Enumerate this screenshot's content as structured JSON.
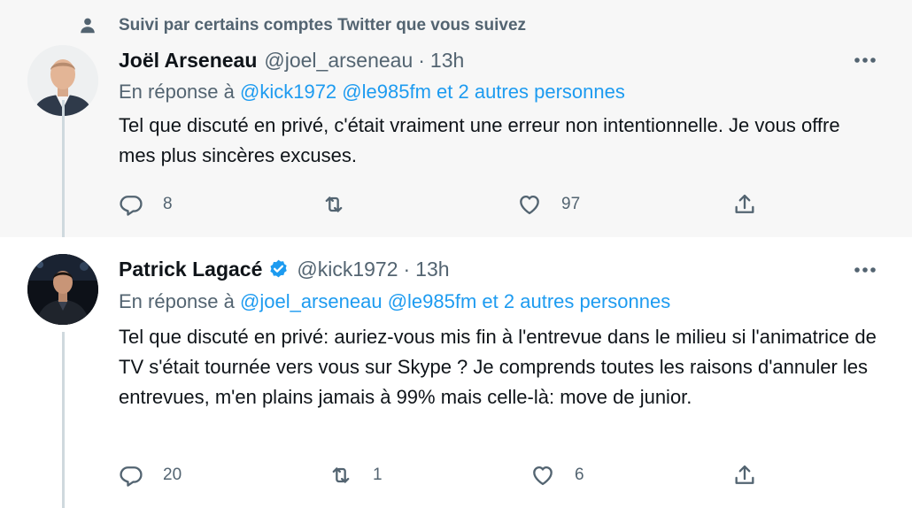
{
  "social_context": {
    "text": "Suivi par certains comptes Twitter que vous suivez",
    "icon": "person-icon"
  },
  "tweets": [
    {
      "name": "Joël Arseneau",
      "handle": "@joel_arseneau",
      "separator": "·",
      "time": "13h",
      "verified": false,
      "reply_prefix": "En réponse à",
      "reply_links": [
        "@kick1972",
        "@le985fm",
        "et 2 autres personnes"
      ],
      "body": "Tel que discuté en privé, c'était vraiment une erreur non intentionnelle. Je vous offre mes plus sincères excuses.",
      "replies": "8",
      "retweets": "",
      "likes": "97"
    },
    {
      "name": "Patrick Lagacé",
      "handle": "@kick1972",
      "separator": "·",
      "time": "13h",
      "verified": true,
      "reply_prefix": "En réponse à",
      "reply_links": [
        "@joel_arseneau",
        "@le985fm",
        "et 2 autres personnes"
      ],
      "body": "Tel que discuté en privé: auriez-vous mis fin à l'entrevue dans le milieu si l'animatrice de TV s'était tournée vers vous sur Skype ? Je comprends toutes les raisons d'annuler les entrevues, m'en plains jamais à 99% mais celle-là: move de junior.",
      "replies": "20",
      "retweets": "1",
      "likes": "6"
    }
  ],
  "colors": {
    "accent": "#1d9bf0",
    "muted": "#536471",
    "text": "#0f1419",
    "verified": "#1d9bf0"
  }
}
